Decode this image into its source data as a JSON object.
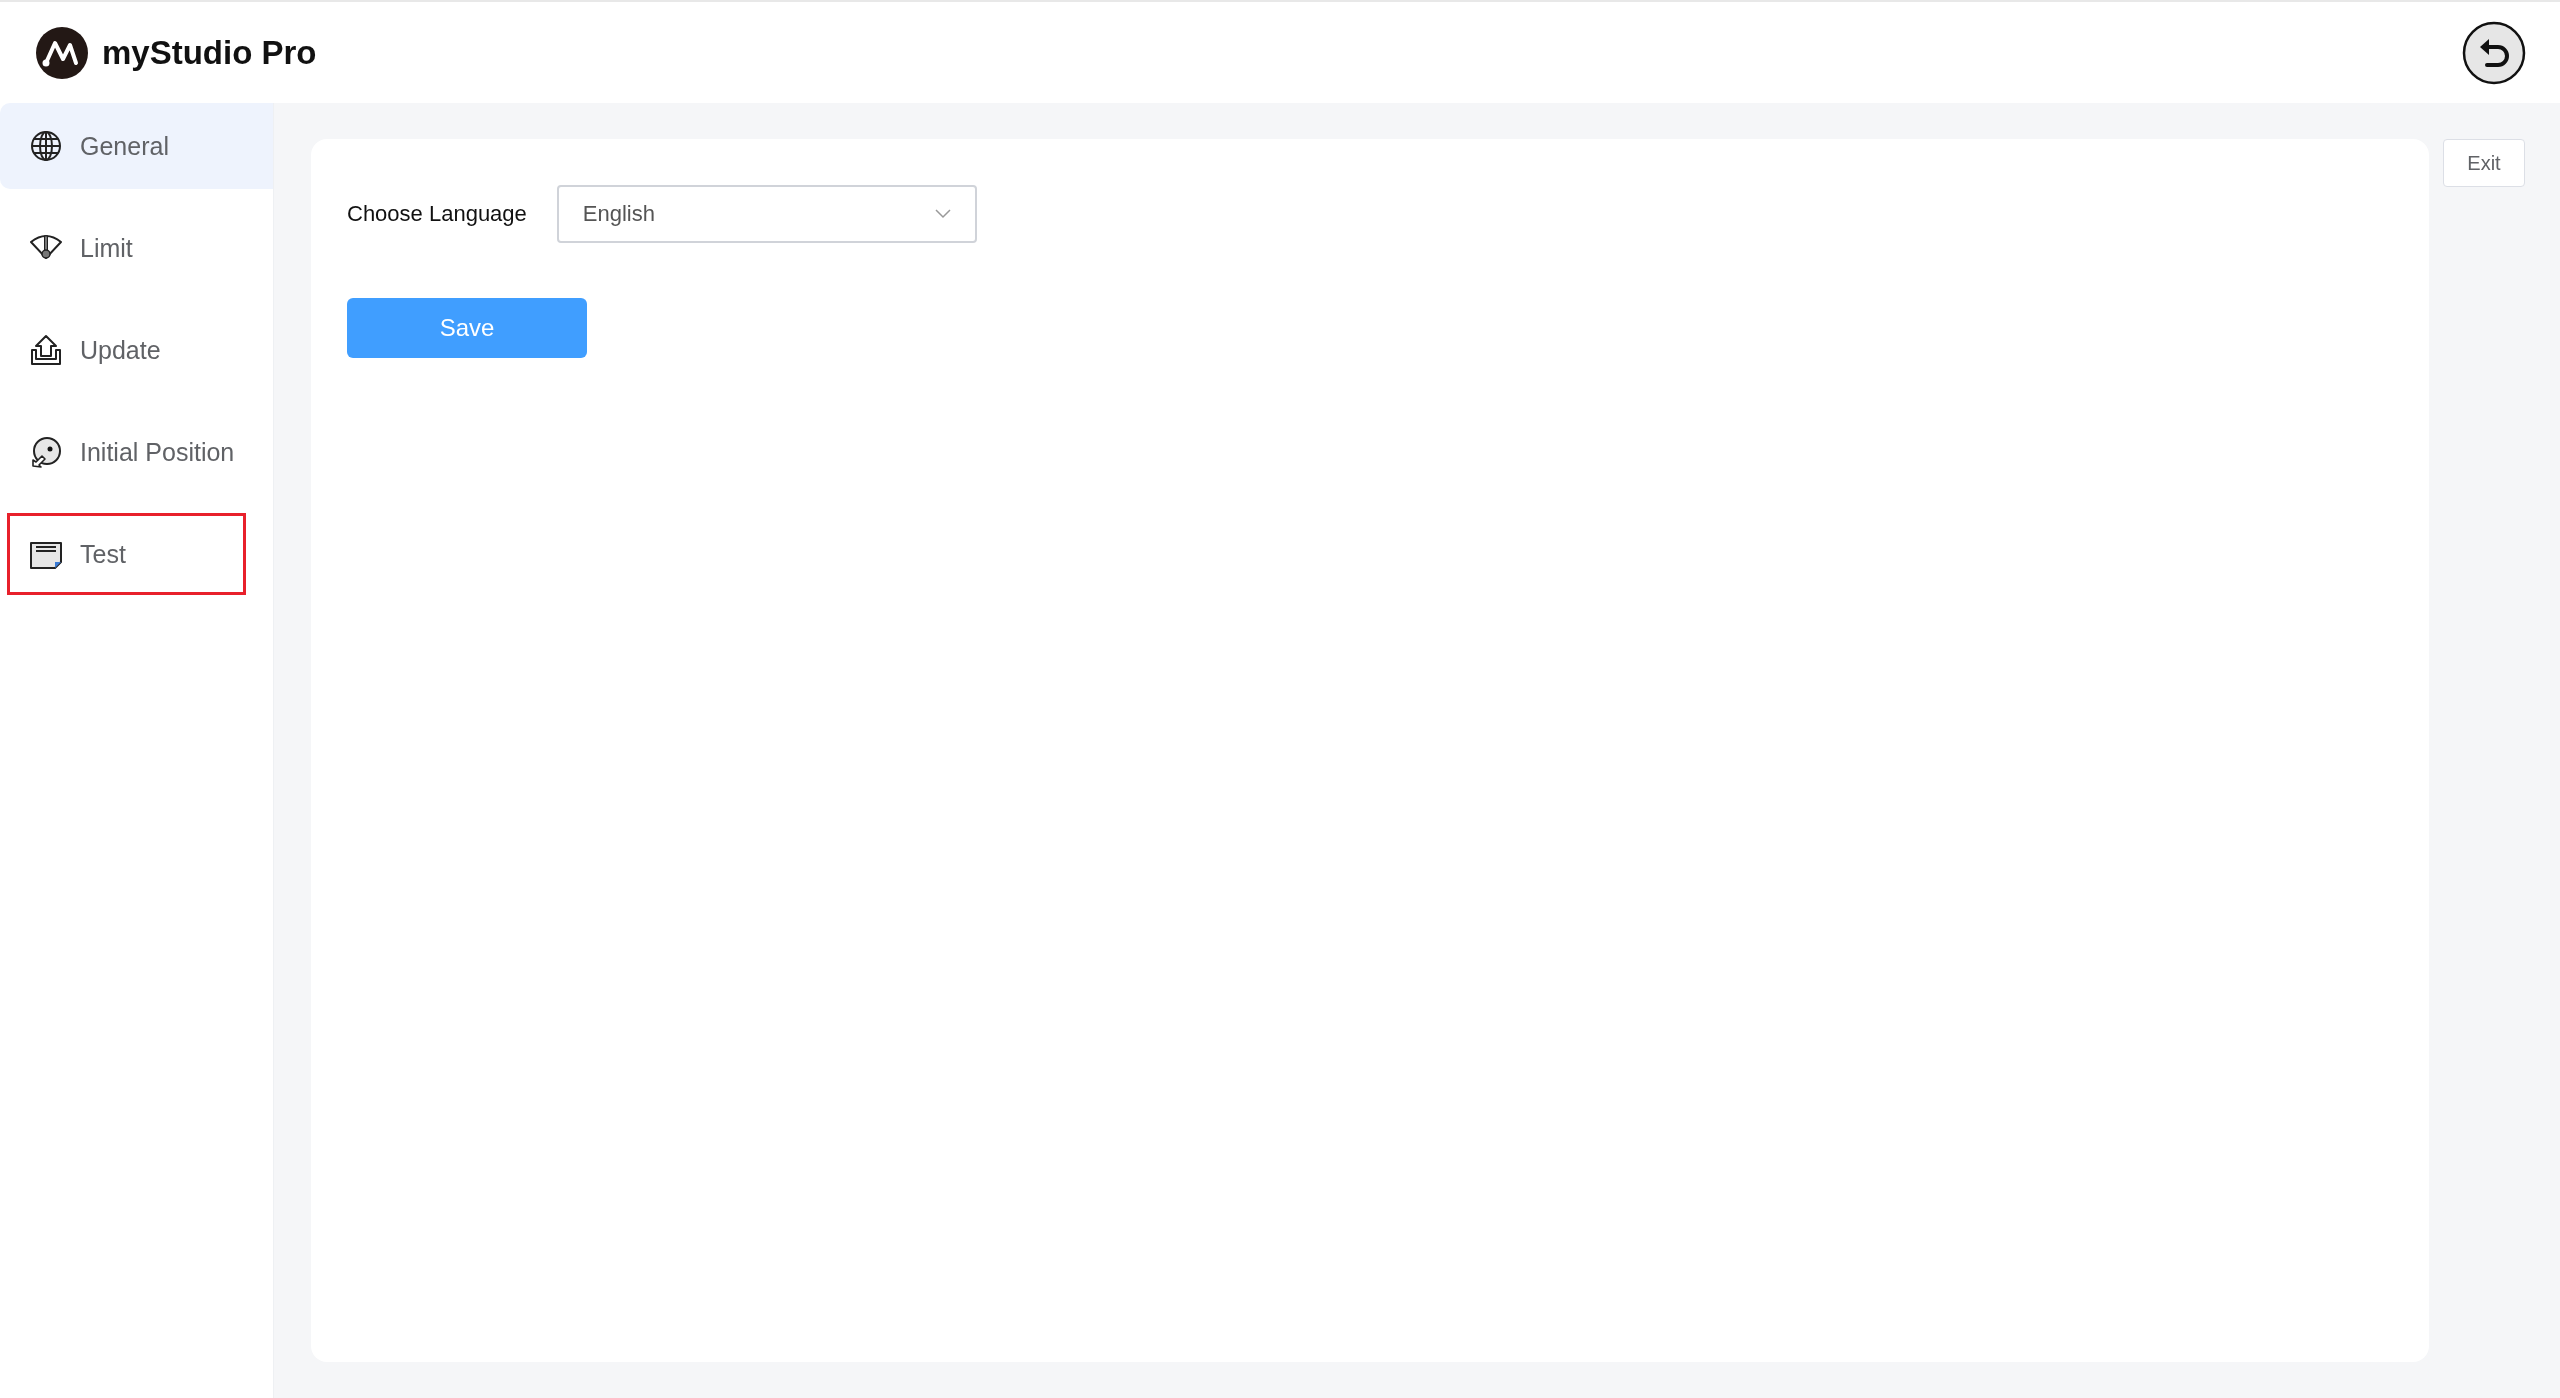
{
  "app": {
    "title": "myStudio Pro"
  },
  "sidebar": {
    "items": [
      {
        "label": "General",
        "selected": true,
        "highlighted": false
      },
      {
        "label": "Limit",
        "selected": false,
        "highlighted": false
      },
      {
        "label": "Update",
        "selected": false,
        "highlighted": false
      },
      {
        "label": "Initial Position",
        "selected": false,
        "highlighted": false
      },
      {
        "label": "Test",
        "selected": false,
        "highlighted": true
      }
    ]
  },
  "form": {
    "language_label": "Choose Language",
    "language_value": "English",
    "save_button": "Save"
  },
  "exit_button": "Exit"
}
